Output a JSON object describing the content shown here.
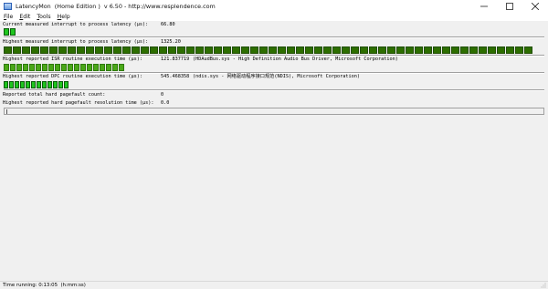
{
  "window": {
    "title": "LatencyMon  (Home Edition )  v 6.50 - http://www.resplendence.com",
    "minimize": "—",
    "maximize": "☐",
    "close": "✕"
  },
  "menu": [
    {
      "mnemonic": "F",
      "rest": "ile"
    },
    {
      "mnemonic": "E",
      "rest": "dit"
    },
    {
      "mnemonic": "T",
      "rest": "ools"
    },
    {
      "mnemonic": "H",
      "rest": "elp"
    }
  ],
  "stats": {
    "current_latency": {
      "label": "Current measured interrupt to process latency (µs):",
      "value": "66.80"
    },
    "highest_latency": {
      "label": "Highest measured interrupt to process latency (µs):",
      "value": "1325.20"
    },
    "highest_isr": {
      "label": "Highest reported ISR routine execution time (µs):",
      "value": "121.837719",
      "detail": "(HDAudBus.sys - High Definition Audio Bus Driver, Microsoft Corporation)"
    },
    "highest_dpc": {
      "label": "Highest reported DPC routine execution time (µs):",
      "value": "545.468358",
      "detail": "(ndis.sys - 网络驱动程序接口规范(NDIS), Microsoft Corporation)"
    },
    "total_pagefault": {
      "label": "Reported total hard pagefault count:",
      "value": "0"
    },
    "highest_pagefault": {
      "label": "Highest reported hard pagefault resolution time (µs):",
      "value": "0.0"
    }
  },
  "bars": {
    "current_latency_segments": 2,
    "highest_latency_segments": 58,
    "highest_isr_segments": 19,
    "highest_dpc_segments": 12
  },
  "status": {
    "text": "Time running: 0:13:05  (h:mm:ss)"
  },
  "colors": {
    "bar_green": "#1ec51e",
    "bar_dark_green": "#2d6e00"
  }
}
